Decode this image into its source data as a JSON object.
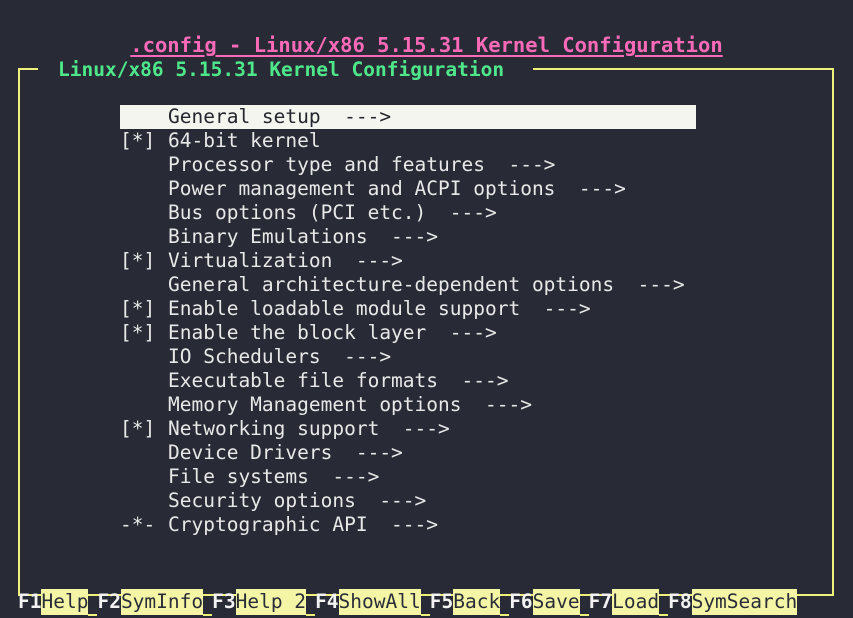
{
  "window": {
    "title": ".config - Linux/x86 5.15.31 Kernel Configuration",
    "title_color": "#fb6ab8",
    "background_color": "#282b36",
    "frame_color": "#edf07a"
  },
  "frame": {
    "legend": "Linux/x86 5.15.31 Kernel Configuration",
    "legend_color": "#4ee88a"
  },
  "menu": {
    "selected_index": 0,
    "selection_bg": "#f5f5ef",
    "selection_fg": "#24262e",
    "items": [
      {
        "flag": "   ",
        "label": "General setup  --->",
        "selected": true
      },
      {
        "flag": "[*]",
        "label": "64-bit kernel",
        "selected": false
      },
      {
        "flag": "   ",
        "label": "Processor type and features  --->",
        "selected": false
      },
      {
        "flag": "   ",
        "label": "Power management and ACPI options  --->",
        "selected": false
      },
      {
        "flag": "   ",
        "label": "Bus options (PCI etc.)  --->",
        "selected": false
      },
      {
        "flag": "   ",
        "label": "Binary Emulations  --->",
        "selected": false
      },
      {
        "flag": "[*]",
        "label": "Virtualization  --->",
        "selected": false
      },
      {
        "flag": "   ",
        "label": "General architecture-dependent options  --->",
        "selected": false
      },
      {
        "flag": "[*]",
        "label": "Enable loadable module support  --->",
        "selected": false
      },
      {
        "flag": "[*]",
        "label": "Enable the block layer  --->",
        "selected": false
      },
      {
        "flag": "   ",
        "label": "IO Schedulers  --->",
        "selected": false
      },
      {
        "flag": "   ",
        "label": "Executable file formats  --->",
        "selected": false
      },
      {
        "flag": "   ",
        "label": "Memory Management options  --->",
        "selected": false
      },
      {
        "flag": "[*]",
        "label": "Networking support  --->",
        "selected": false
      },
      {
        "flag": "   ",
        "label": "Device Drivers  --->",
        "selected": false
      },
      {
        "flag": "   ",
        "label": "File systems  --->",
        "selected": false
      },
      {
        "flag": "   ",
        "label": "Security options  --->",
        "selected": false
      },
      {
        "flag": "-*-",
        "label": "Cryptographic API  --->",
        "selected": false
      }
    ]
  },
  "function_keys": {
    "highlight_bg": "#f4f6a6",
    "highlight_fg": "#2a2d38",
    "key_color": "#f2f2f2",
    "items": [
      {
        "key": "F1",
        "desc": "Help"
      },
      {
        "key": "F2",
        "desc": "SymInfo"
      },
      {
        "key": "F3",
        "desc": "Help 2"
      },
      {
        "key": "F4",
        "desc": "ShowAll"
      },
      {
        "key": "F5",
        "desc": "Back"
      },
      {
        "key": "F6",
        "desc": "Save"
      },
      {
        "key": "F7",
        "desc": "Load"
      },
      {
        "key": "F8",
        "desc": "SymSearch"
      }
    ]
  }
}
